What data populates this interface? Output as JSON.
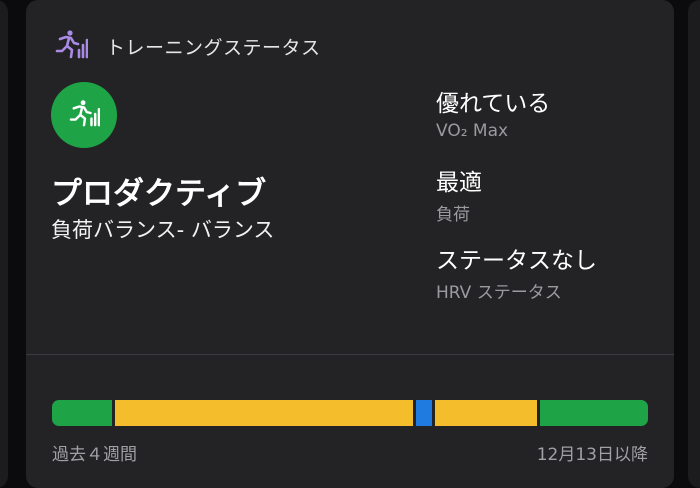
{
  "header": {
    "title": "トレーニングステータス",
    "icon": "training-runner-icon",
    "icon_color": "#a98be6"
  },
  "status": {
    "title": "プロダクティブ",
    "subtitle": "負荷バランス- バランス",
    "badge_icon": "training-runner-icon",
    "badge_color": "#1ea447"
  },
  "metrics": [
    {
      "value": "優れている",
      "label": "VO₂ Max"
    },
    {
      "value": "最適",
      "label": "負荷"
    },
    {
      "value": "ステータスなし",
      "label": "HRV ステータス"
    }
  ],
  "timeline": {
    "segments": [
      {
        "status": "productive",
        "color": "#1ea447",
        "fraction": 0.106
      },
      {
        "status": "maintaining",
        "color": "#f4bd2c",
        "fraction": 0.505
      },
      {
        "status": "peaking",
        "color": "#1f7be0",
        "fraction": 0.032
      },
      {
        "status": "maintaining",
        "color": "#f4bd2c",
        "fraction": 0.176
      },
      {
        "status": "productive",
        "color": "#1ea447",
        "fraction": 0.181
      }
    ],
    "start_label": "過去４週間",
    "end_label": "12月13日以降"
  }
}
